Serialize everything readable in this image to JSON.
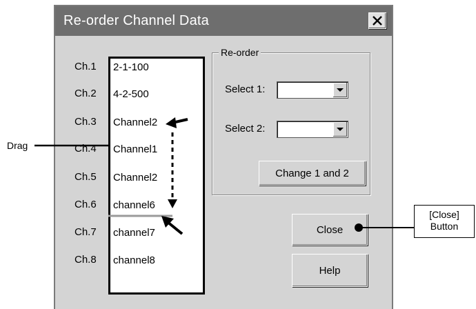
{
  "dialog": {
    "title": "Re-order Channel Data"
  },
  "channels": {
    "labels": [
      "Ch.1",
      "Ch.2",
      "Ch.3",
      "Ch.4",
      "Ch.5",
      "Ch.6",
      "Ch.7",
      "Ch.8"
    ],
    "items": [
      "2-1-100",
      "4-2-500",
      "Channel2",
      "Channel1",
      "Channel2",
      "channel6",
      "channel7",
      "channel8"
    ]
  },
  "reorder": {
    "group_label": "Re-order",
    "select1_label": "Select 1:",
    "select1_value": "",
    "select2_label": "Select 2:",
    "select2_value": "",
    "change_button": "Change 1 and 2"
  },
  "buttons": {
    "close": "Close",
    "help": "Help"
  },
  "annotations": {
    "drag": "Drag",
    "close_callout_line1": "[Close]",
    "close_callout_line2": "Button"
  },
  "icons": {
    "dialog_close": "close-icon",
    "combo_arrow": "chevron-down-icon"
  }
}
